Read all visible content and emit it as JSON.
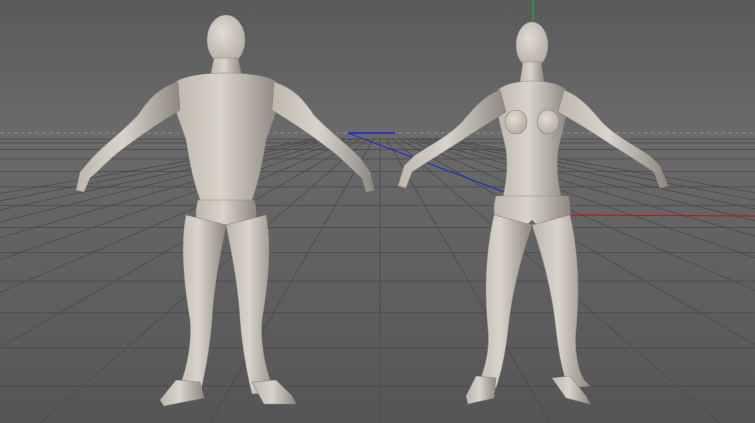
{
  "viewport": {
    "colors": {
      "sky_top": "#5a5a5a",
      "sky_bottom": "#6b6b6b",
      "floor_near": "#555555",
      "floor_far": "#6a6a6a",
      "grid_line": "#4a4a4a",
      "horizon_dashes": "#8e8e8e",
      "axis_x": "#c0101a",
      "axis_y": "#18b838",
      "axis_z": "#1a2bd0",
      "mesh_light": "#d9d4cb",
      "mesh_mid": "#bdb7ad",
      "mesh_shadow": "#8c8780"
    },
    "scene_objects": [
      {
        "name": "male-base-mesh",
        "pose": "A-pose"
      },
      {
        "name": "female-base-mesh",
        "pose": "A-pose"
      }
    ]
  }
}
